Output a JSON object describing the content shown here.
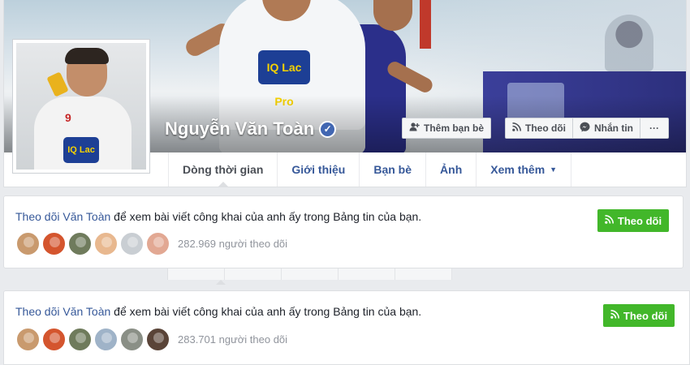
{
  "profile": {
    "name": "Nguyễn Văn Toàn",
    "verified_mark": "✓",
    "avatar_badge": "IQ Lac Pro",
    "avatar_number": "9",
    "cover_badge": "IQ Lac Pro"
  },
  "actions": {
    "add_friend": "Thêm bạn bè",
    "follow": "Theo dõi",
    "message": "Nhắn tin",
    "more": "···"
  },
  "icons": {
    "add_friend": "add-friend-icon",
    "follow": "rss-icon",
    "message": "messenger-icon",
    "more": "more-dots-icon",
    "verified": "verified-badge-icon",
    "caret": "caret-down-icon"
  },
  "tabs": [
    {
      "label": "Dòng thời gian",
      "active": true
    },
    {
      "label": "Giới thiệu"
    },
    {
      "label": "Bạn bè"
    },
    {
      "label": "Ảnh"
    },
    {
      "label": "Xem thêm",
      "caret": "▼"
    }
  ],
  "follow_cards": [
    {
      "link_text": "Theo dõi Văn Toàn",
      "rest_text": " để xem bài viết công khai của anh ấy trong Bảng tin của bạn.",
      "button_label": "Theo dõi",
      "follower_count": "282.969 người theo dõi",
      "follower_avatars": [
        "#c99a6e",
        "#d4552e",
        "#6f7b5c",
        "#e8b88f",
        "#c9ced3",
        "#e2a893"
      ]
    },
    {
      "link_text": "Theo dõi Văn Toàn",
      "rest_text": " để xem bài viết công khai của anh ấy trong Bảng tin của bạn.",
      "button_label": "Theo dõi",
      "follower_count": "283.701 người theo dõi",
      "follower_avatars": [
        "#c99a6e",
        "#d4552e",
        "#6f7b5c",
        "#9fb3c8",
        "#8a8f86",
        "#5a4438"
      ]
    }
  ],
  "colors": {
    "link": "#365899",
    "follow_button": "#42b72a",
    "verified": "#4267b2",
    "page_background": "#e9ebee"
  }
}
